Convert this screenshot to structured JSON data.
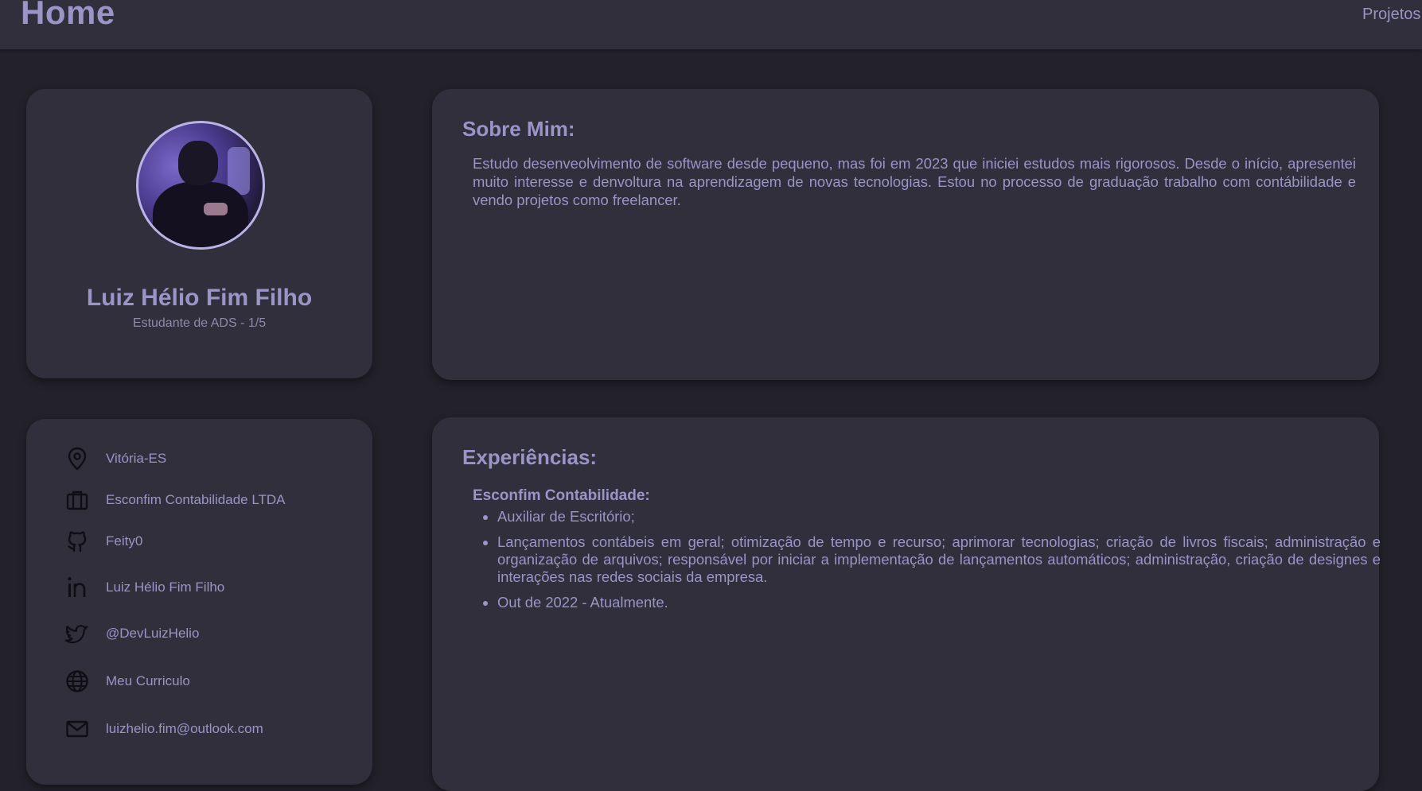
{
  "header": {
    "title": "Home",
    "nav_projects": "Projetos"
  },
  "profile": {
    "name": "Luiz Hélio Fim Filho",
    "role": "Estudante de ADS - 1/5"
  },
  "about": {
    "heading": "Sobre Mim:",
    "text": "Estudo desenveolvimento de software desde pequeno, mas foi em 2023 que iniciei estudos mais rigorosos. Desde o início, apresentei muito interesse e denvoltura na aprendizagem de novas tecnologias. Estou no processo de graduação trabalho com contábilidade e vendo projetos como freelancer."
  },
  "contacts": [
    {
      "icon": "location-pin-icon",
      "label": "Vitória-ES"
    },
    {
      "icon": "briefcase-icon",
      "label": "Esconfim Contabilidade LTDA"
    },
    {
      "icon": "github-icon",
      "label": "Feity0"
    },
    {
      "icon": "linkedin-icon",
      "label": "Luiz Hélio Fim Filho"
    },
    {
      "icon": "twitter-icon",
      "label": "@DevLuizHelio"
    },
    {
      "icon": "globe-icon",
      "label": "Meu Curriculo"
    },
    {
      "icon": "mail-icon",
      "label": "luizhelio.fim@outlook.com"
    }
  ],
  "experience": {
    "heading": "Experiências:",
    "company": "Esconfim Contabilidade:",
    "items": [
      "Auxiliar de Escritório;",
      "Lançamentos contábeis em geral; otimização de tempo e recurso; aprimorar tecnologias; criação de livros fiscais; administração e organização de arquivos; responsável por iniciar a implementação de lançamentos automáticos; administração, criação de designes e interações nas redes sociais da empresa.",
      "Out de 2022 - Atualmente."
    ]
  },
  "colors": {
    "background": "#23222b",
    "card": "#302f3b",
    "accent_text": "#9a94c7",
    "icon": "#0f0e14"
  }
}
